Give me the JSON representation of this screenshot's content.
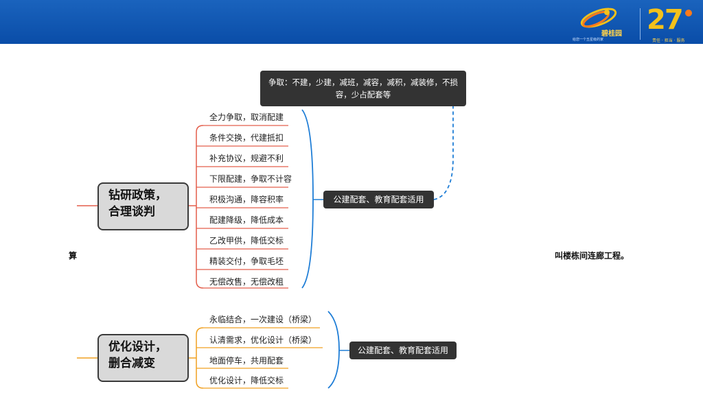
{
  "header": {
    "brand_name": "碧桂园",
    "brand_sub": "给您一个五星级的家",
    "anniversary_number": "27",
    "anniversary_sub": "责任 · 担当 · 服务"
  },
  "colors": {
    "header_blue": "#0a4da8",
    "red_branch": "#e35d4a",
    "orange_branch": "#f0a020",
    "blue_bracket": "#1e7dd6",
    "tag_bg": "#333333"
  },
  "group1": {
    "topic": "钻研政策，\n合理谈判",
    "items": [
      "全力争取，取消配建",
      "条件交换，代建抵扣",
      "补充协议，规避不利",
      "下限配建，争取不计容",
      "积极沟通，降容积率",
      "配建降级，降低成本",
      "乙改甲供，降低交标",
      "精装交付，争取毛坯",
      "无偿改售，无偿改租"
    ],
    "tag": "公建配套、教育配套适用",
    "callout": "争取：不建，少建，减班，减容，减积，减装修，不损容，少占配套等"
  },
  "group2": {
    "topic": "优化设计，\n删合减变",
    "items": [
      "永临结合，一次建设（桥梁）",
      "认清需求，优化设计（桥梁）",
      "地面停车，共用配套",
      "优化设计，降低交标"
    ],
    "tag": "公建配套、教育配套适用"
  },
  "fragments": {
    "left": "算",
    "right": "叫楼栋间连廊工程。"
  }
}
